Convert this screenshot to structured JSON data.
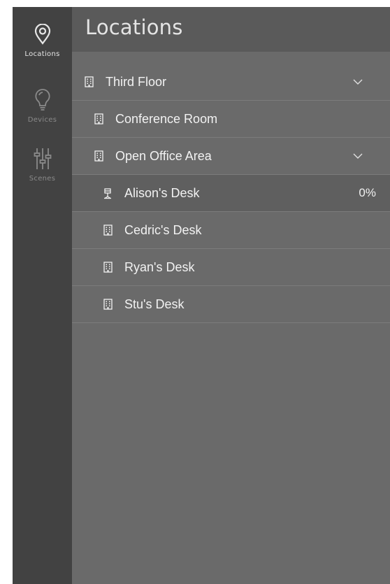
{
  "nav": {
    "items": [
      {
        "label": "Locations",
        "icon": "location-pin-icon",
        "active": true
      },
      {
        "label": "Devices",
        "icon": "lightbulb-icon",
        "active": false
      },
      {
        "label": "Scenes",
        "icon": "sliders-icon",
        "active": false
      }
    ]
  },
  "header": {
    "title": "Locations"
  },
  "tree": {
    "rows": [
      {
        "label": "Third Floor",
        "icon": "building-icon",
        "expandable": true
      },
      {
        "label": "Conference Room",
        "icon": "building-icon",
        "expandable": false
      },
      {
        "label": "Open Office Area",
        "icon": "building-icon",
        "expandable": true
      },
      {
        "label": "Alison's Desk",
        "icon": "desk-lamp-icon",
        "value": "0%",
        "selected": true
      },
      {
        "label": "Cedric's Desk",
        "icon": "building-icon"
      },
      {
        "label": "Ryan's Desk",
        "icon": "building-icon"
      },
      {
        "label": "Stu's Desk",
        "icon": "building-icon"
      }
    ]
  },
  "colors": {
    "rail_bg": "#424242",
    "header_bg": "#5a5a5a",
    "content_bg": "#6a6a6a",
    "selected_row_bg": "#5f5f5f"
  }
}
